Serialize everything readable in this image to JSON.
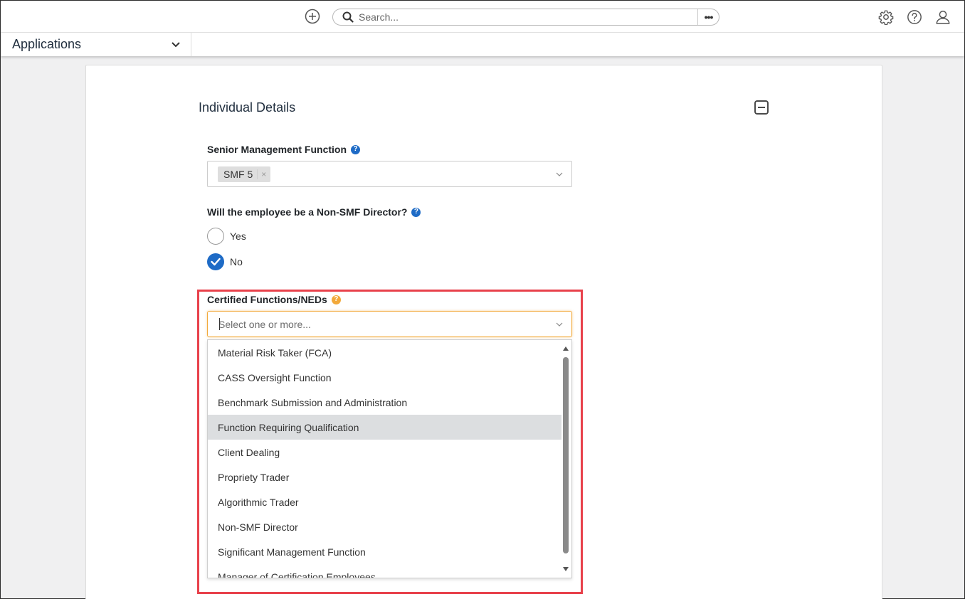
{
  "topbar": {
    "search_placeholder": "Search...",
    "more_label": "•••"
  },
  "appbar": {
    "label": "Applications"
  },
  "form": {
    "section_title": "Individual Details",
    "smf": {
      "label": "Senior Management Function",
      "tag": "SMF 5",
      "tag_remove": "×"
    },
    "non_smf": {
      "label": "Will the employee be a Non-SMF Director?",
      "options": [
        {
          "label": "Yes",
          "selected": false
        },
        {
          "label": "No",
          "selected": true
        }
      ]
    },
    "certified": {
      "label": "Certified Functions/NEDs",
      "placeholder": "Select one or more...",
      "options": [
        "Material Risk Taker (FCA)",
        "CASS Oversight Function",
        "Benchmark Submission and Administration",
        "Function Requiring Qualification",
        "Client Dealing",
        "Propriety Trader",
        "Algorithmic Trader",
        "Non-SMF Director",
        "Significant Management Function",
        "Manager of Certification Employees"
      ],
      "hovered_option": "Function Requiring Qualification"
    }
  },
  "colors": {
    "accent_blue": "#1e6bc6",
    "focus_orange": "#f2a93b",
    "highlight_red": "#e8414b"
  },
  "icons": {
    "add": "plus-circle-icon",
    "search": "search-icon",
    "settings": "gear-icon",
    "help": "question-circle-icon",
    "user": "user-icon"
  }
}
